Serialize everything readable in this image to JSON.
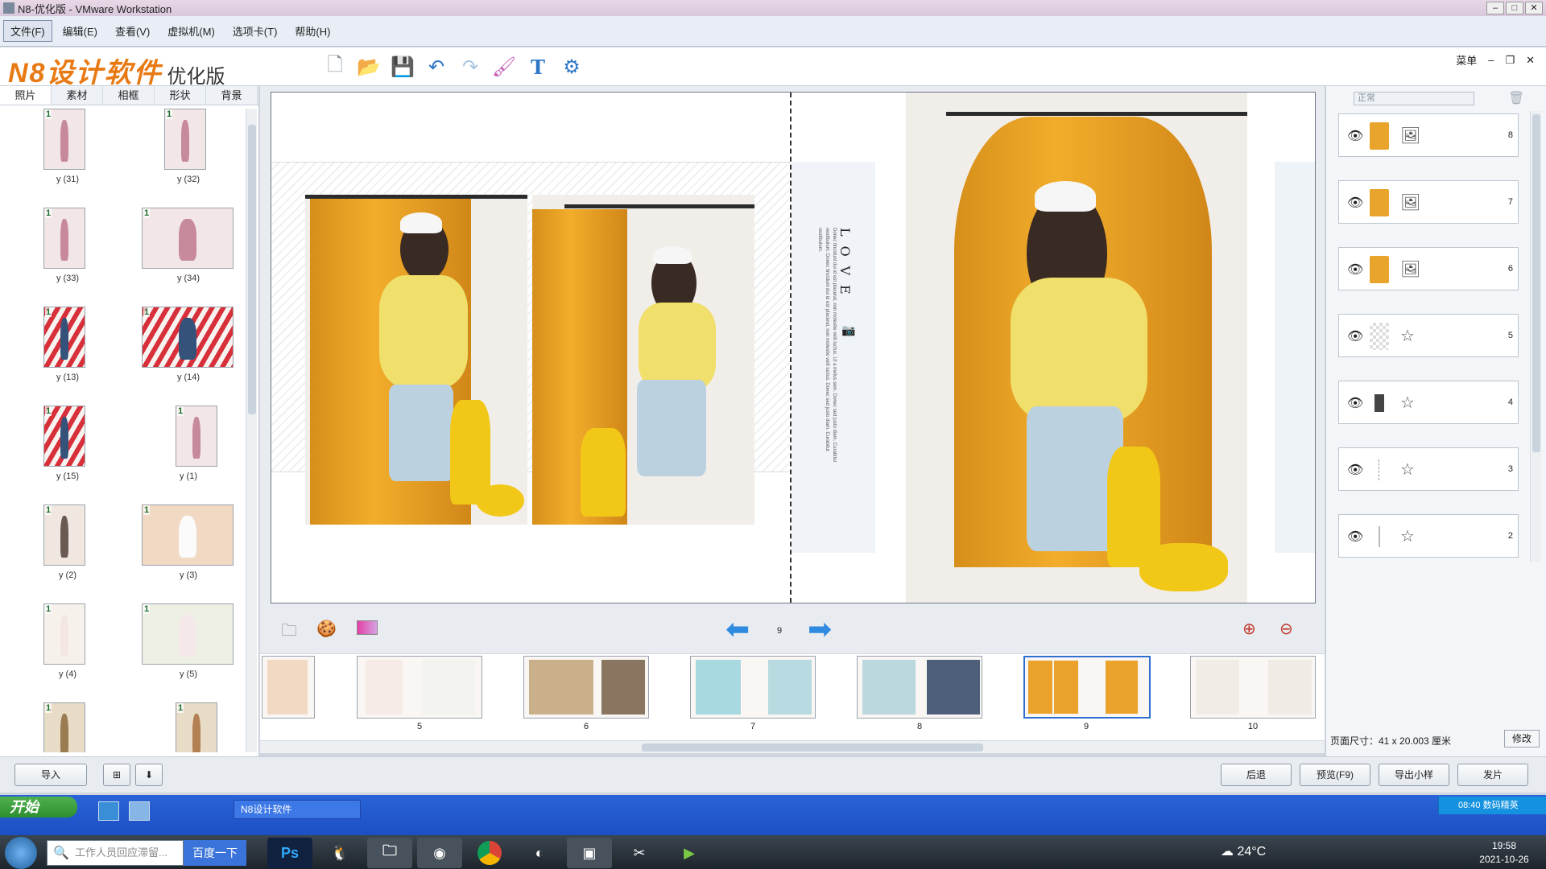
{
  "vm_window": {
    "title": "N8-优化版 - VMware Workstation",
    "menu": [
      "文件(F)",
      "编辑(E)",
      "查看(V)",
      "虚拟机(M)",
      "选项卡(T)",
      "帮助(H)"
    ]
  },
  "app": {
    "brand": "N8设计软件",
    "edition": "优化版",
    "menu_label": "菜单",
    "left_tabs": [
      "照片",
      "素材",
      "相框",
      "形状",
      "背景"
    ],
    "photos": [
      {
        "badge": "1",
        "label": "y (31)"
      },
      {
        "badge": "1",
        "label": "y (32)"
      },
      {
        "badge": "1",
        "label": "y (33)"
      },
      {
        "badge": "1",
        "label": "y (34)"
      },
      {
        "badge": "1",
        "label": "y (13)"
      },
      {
        "badge": "1",
        "label": "y (14)"
      },
      {
        "badge": "1",
        "label": "y (15)"
      },
      {
        "badge": "1",
        "label": "y (1)"
      },
      {
        "badge": "1",
        "label": "y (2)"
      },
      {
        "badge": "1",
        "label": "y (3)"
      },
      {
        "badge": "1",
        "label": "y (4)"
      },
      {
        "badge": "1",
        "label": "y (5)"
      },
      {
        "badge": "1",
        "label": ""
      },
      {
        "badge": "1",
        "label": ""
      }
    ],
    "spread_text": {
      "love": "LOVE",
      "small": "Donec tincidunt dui id est placerat, non molestie velit luctus. Ut a metus sem. Donec sed justo diam. Curabitur vestibulum. Donec tincidunt dui id est placerat, non molestie velit luctus. Donec sed justo diam. Curabitur vestibulum."
    },
    "current_page": "9",
    "filmstrip": [
      "",
      "5",
      "6",
      "7",
      "8",
      "9",
      "10"
    ],
    "blend_mode": "正常",
    "layers": [
      {
        "num": "8",
        "type": "image"
      },
      {
        "num": "7",
        "type": "image"
      },
      {
        "num": "6",
        "type": "image"
      },
      {
        "num": "5",
        "type": "star"
      },
      {
        "num": "4",
        "type": "star"
      },
      {
        "num": "3",
        "type": "star"
      },
      {
        "num": "2",
        "type": "star"
      }
    ],
    "page_size": "页面尺寸：41 x 20.003 厘米",
    "modify": "修改",
    "buttons": {
      "import": "导入",
      "back": "后退",
      "preview": "预览(F9)",
      "export_sample": "导出小样",
      "send": "发片"
    }
  },
  "xp_taskbar": {
    "start": "开始",
    "task": "N8设计软件",
    "tray": "08:40 数码精英"
  },
  "win7_taskbar": {
    "search_placeholder": "工作人员回应滞留...",
    "search_button": "百度一下",
    "weather": "24°C",
    "time": "19:58",
    "date": "2021-10-26"
  },
  "colors": {
    "accent_blue": "#2f8be0",
    "brand_orange": "#e87a14",
    "drape_orange": "#f2ad2b"
  }
}
